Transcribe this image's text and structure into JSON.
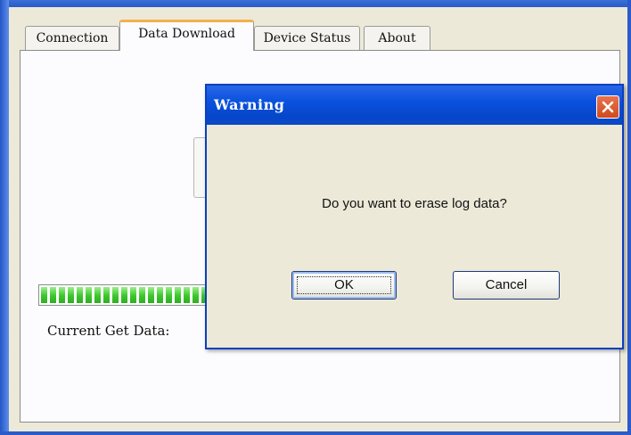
{
  "tabs": [
    {
      "label": "Connection",
      "active": false
    },
    {
      "label": "Data Download",
      "active": true
    },
    {
      "label": "Device Status",
      "active": false
    },
    {
      "label": "About",
      "active": false
    }
  ],
  "panel": {
    "progress_percent": 80,
    "current_label": "Current Get Data:"
  },
  "dialog": {
    "title": "Warning",
    "message": "Do you want to erase log data?",
    "ok_label": "OK",
    "cancel_label": "Cancel",
    "close_icon": "close-icon"
  },
  "colors": {
    "titlebar": "#0a52de",
    "progress_fill": "#3cc62c",
    "active_tab_accent": "#f4b14a",
    "close_button": "#d04a1e"
  }
}
